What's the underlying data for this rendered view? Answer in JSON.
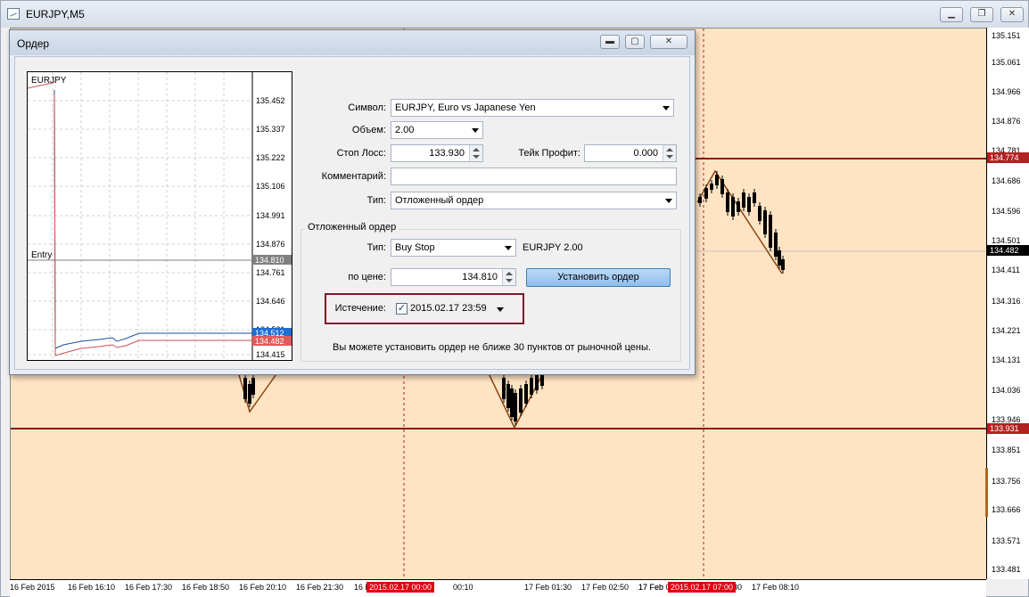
{
  "window": {
    "title": "EURJPY,M5",
    "controls": [
      "minimize",
      "maximize",
      "close"
    ]
  },
  "price_axis": {
    "ticks": [
      "135.151",
      "135.061",
      "134.966",
      "134.876",
      "134.781",
      "134.686",
      "134.596",
      "134.501",
      "134.411",
      "134.316",
      "134.221",
      "134.131",
      "134.036",
      "133.946",
      "133.851",
      "133.756",
      "133.666",
      "133.571",
      "133.481"
    ],
    "tags": [
      {
        "text": "134.774",
        "color": "#b22222"
      },
      {
        "text": "134.482",
        "color": "#000000"
      },
      {
        "text": "133.931",
        "color": "#b22222"
      }
    ]
  },
  "time_axis": {
    "ticks": [
      "16 Feb 2015",
      "16 Feb 16:10",
      "16 Feb 17:30",
      "16 Feb 18:50",
      "16 Feb 20:10",
      "16 Feb 21:30",
      "16 Fe",
      "00:10",
      "17 Feb 01:30",
      "17 Feb 02:50",
      "17 Feb 04:10",
      "17 Feb 05:30",
      "17 Feb",
      "17 Feb 08:10"
    ],
    "tags": [
      "2015.02.17 00:00",
      "2015.02.17 07:00"
    ]
  },
  "colors": {
    "plot_bg": "#ffe4c4",
    "level_line": "#8b1a1a",
    "zigzag": "#8b4513",
    "tag_red": "#e0000f"
  },
  "dialog": {
    "title": "Ордер",
    "mini_chart": {
      "symbol": "EURJPY",
      "entry_label": "Entry",
      "ticks": [
        "135.452",
        "135.337",
        "135.222",
        "135.106",
        "134.991",
        "134.876",
        "134.761",
        "134.646",
        "134.531",
        "134.415"
      ],
      "tags": [
        {
          "text": "134.810",
          "color": "#808080"
        },
        {
          "text": "134.512",
          "color": "#1f6fd1"
        },
        {
          "text": "134.482",
          "color": "#e05a5a"
        }
      ]
    },
    "form": {
      "symbol_label": "Символ:",
      "symbol_value": "EURJPY, Euro vs Japanese Yen",
      "volume_label": "Объем:",
      "volume_value": "2.00",
      "sl_label": "Стоп Лосс:",
      "sl_value": "133.930",
      "tp_label": "Тейк Профит:",
      "tp_value": "0.000",
      "comment_label": "Комментарий:",
      "comment_value": "",
      "type_label": "Тип:",
      "type_value": "Отложенный ордер"
    },
    "pending": {
      "group_title": "Отложенный ордер",
      "type_label": "Тип:",
      "type_value": "Buy Stop",
      "type_info": "EURJPY 2.00",
      "price_label": "по цене:",
      "price_value": "134.810",
      "set_button": "Установить ордер",
      "expiry_label": "Истечение:",
      "expiry_checked": "✓",
      "expiry_value": "2015.02.17 23:59",
      "hint": "Вы можете установить ордер не ближе 30 пунктов от рыночной цены."
    }
  }
}
